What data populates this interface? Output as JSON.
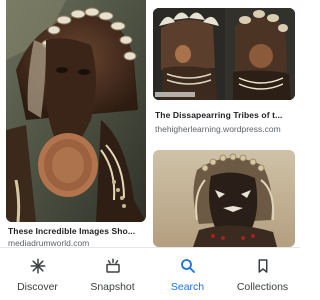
{
  "results": [
    {
      "title": "These Incredible Images Sho...",
      "source": "mediadrumworld.com"
    },
    {
      "title": "The Dissapearring Tribes of t...",
      "source": "thehigherlearning.wordpress.com"
    },
    {
      "title": "",
      "source": ""
    }
  ],
  "nav": {
    "items": [
      {
        "label": "Discover",
        "icon": "asterisk-icon"
      },
      {
        "label": "Snapshot",
        "icon": "snapshot-icon"
      },
      {
        "label": "Search",
        "icon": "search-icon"
      },
      {
        "label": "Collections",
        "icon": "bookmark-icon"
      }
    ],
    "active": "Search",
    "active_color": "#1a73e8"
  }
}
